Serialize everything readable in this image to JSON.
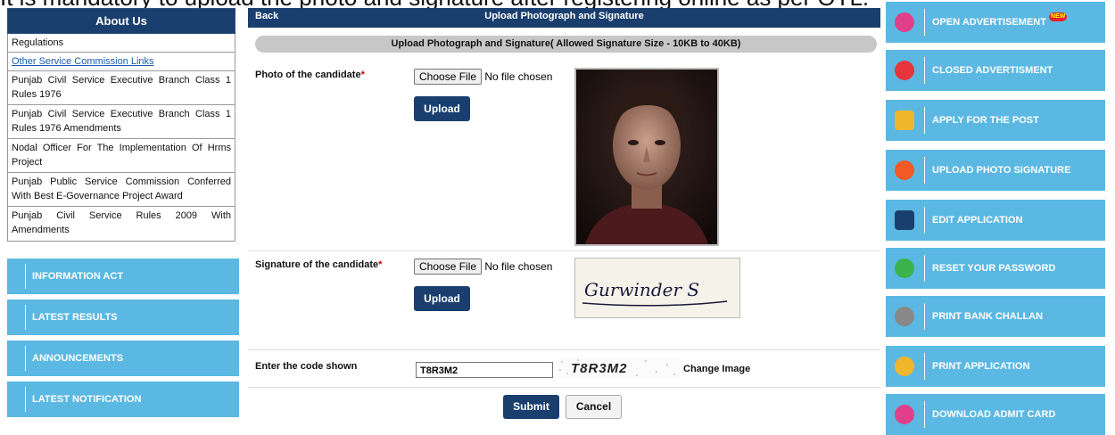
{
  "banner": "It is mandatory to upload the photo and signature after registering online as per OTL.",
  "sidebar": {
    "header": "About Us",
    "items": [
      "Regulations",
      "Other Service Commission Links",
      "Punjab Civil Service Executive Branch Class 1 Rules 1976",
      "Punjab Civil Service Executive Branch Class 1 Rules 1976 Amendments",
      "Nodal Officer For The Implementation Of Hrms Project",
      "Punjab Public Service Commission Conferred With Best E-Governance Project Award",
      "Punjab Civil Service Rules 2009 With Amendments"
    ],
    "nav": [
      "INFORMATION ACT",
      "LATEST RESULTS",
      "ANNOUNCEMENTS",
      "LATEST NOTIFICATION"
    ]
  },
  "main": {
    "back": "Back",
    "title": "Upload Photograph and Signature",
    "subtitle": "Upload Photograph and Signature( Allowed Signature Size - 10KB to 40KB)",
    "photo_label": "Photo of the candidate",
    "signature_label": "Signature of the candidate",
    "required_mark": "*",
    "choose_file": "Choose File",
    "no_file": "No file chosen",
    "upload": "Upload",
    "signature_text": "Gurwinder S",
    "code_label": "Enter the code shown",
    "code_value": "T8R3M2",
    "captcha_text": "T8R3M2",
    "change_image": "Change Image",
    "submit": "Submit",
    "cancel": "Cancel"
  },
  "right_menu": [
    {
      "label": "OPEN ADVERTISEMENT",
      "icon": "newspaper-icon",
      "color": "#e0408a",
      "badge": "NEW"
    },
    {
      "label": "CLOSED ADVERTISMENT",
      "icon": "close-circle-icon",
      "color": "#e8343c"
    },
    {
      "label": "APPLY FOR THE POST",
      "icon": "form-icon",
      "color": "#f0b62c"
    },
    {
      "label": "UPLOAD PHOTO SIGNATURE",
      "icon": "upload-arrow-icon",
      "color": "#f15a24"
    },
    {
      "label": "EDIT APPLICATION",
      "icon": "edit-icon",
      "color": "#1a3f6f"
    },
    {
      "label": "RESET YOUR PASSWORD",
      "icon": "lock-icon",
      "color": "#3cb44b"
    },
    {
      "label": "PRINT BANK CHALLAN",
      "icon": "document-icon",
      "color": "#888888"
    },
    {
      "label": "PRINT APPLICATION",
      "icon": "printer-icon",
      "color": "#f0b62c"
    },
    {
      "label": "DOWNLOAD ADMIT CARD",
      "icon": "download-icon",
      "color": "#e0408a"
    }
  ]
}
